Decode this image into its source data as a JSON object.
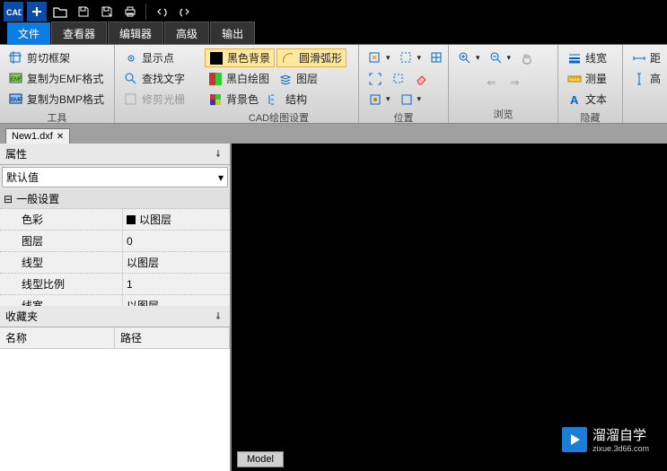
{
  "qat": {
    "app": "CAD"
  },
  "tabs": [
    "文件",
    "查看器",
    "编辑器",
    "高级",
    "输出"
  ],
  "activeTab": 0,
  "ribbon": {
    "tools": {
      "label": "工具",
      "items": [
        "剪切框架",
        "复制为EMF格式",
        "复制为BMP格式"
      ]
    },
    "tools2": {
      "items": [
        "显示点",
        "查找文字",
        "修剪光栅"
      ]
    },
    "cad_settings": {
      "label": "CAD绘图设置",
      "items": [
        "黑色背景",
        "黑白绘图",
        "背景色",
        "圆滑弧形",
        "图层",
        "结构"
      ]
    },
    "position": {
      "label": "位置"
    },
    "browse": {
      "label": "浏览"
    },
    "hide": {
      "label": "隐藏",
      "items": [
        "线宽",
        "测量",
        "文本",
        "距",
        "高"
      ]
    }
  },
  "docTab": "New1.dxf",
  "panels": {
    "props": "属性",
    "defaultLabel": "默认值",
    "section": "一般设置",
    "rows": [
      {
        "k": "色彩",
        "v": "以图层",
        "color": true
      },
      {
        "k": "图层",
        "v": "0"
      },
      {
        "k": "线型",
        "v": "以图层"
      },
      {
        "k": "线型比例",
        "v": "1"
      },
      {
        "k": "线宽",
        "v": "以图层"
      }
    ],
    "fav": "收藏夹",
    "favCols": [
      "名称",
      "路径"
    ]
  },
  "viewport": {
    "modelTab": "Model",
    "watermark": "溜溜自学",
    "watermarkUrl": "zixue.3d66.com"
  }
}
